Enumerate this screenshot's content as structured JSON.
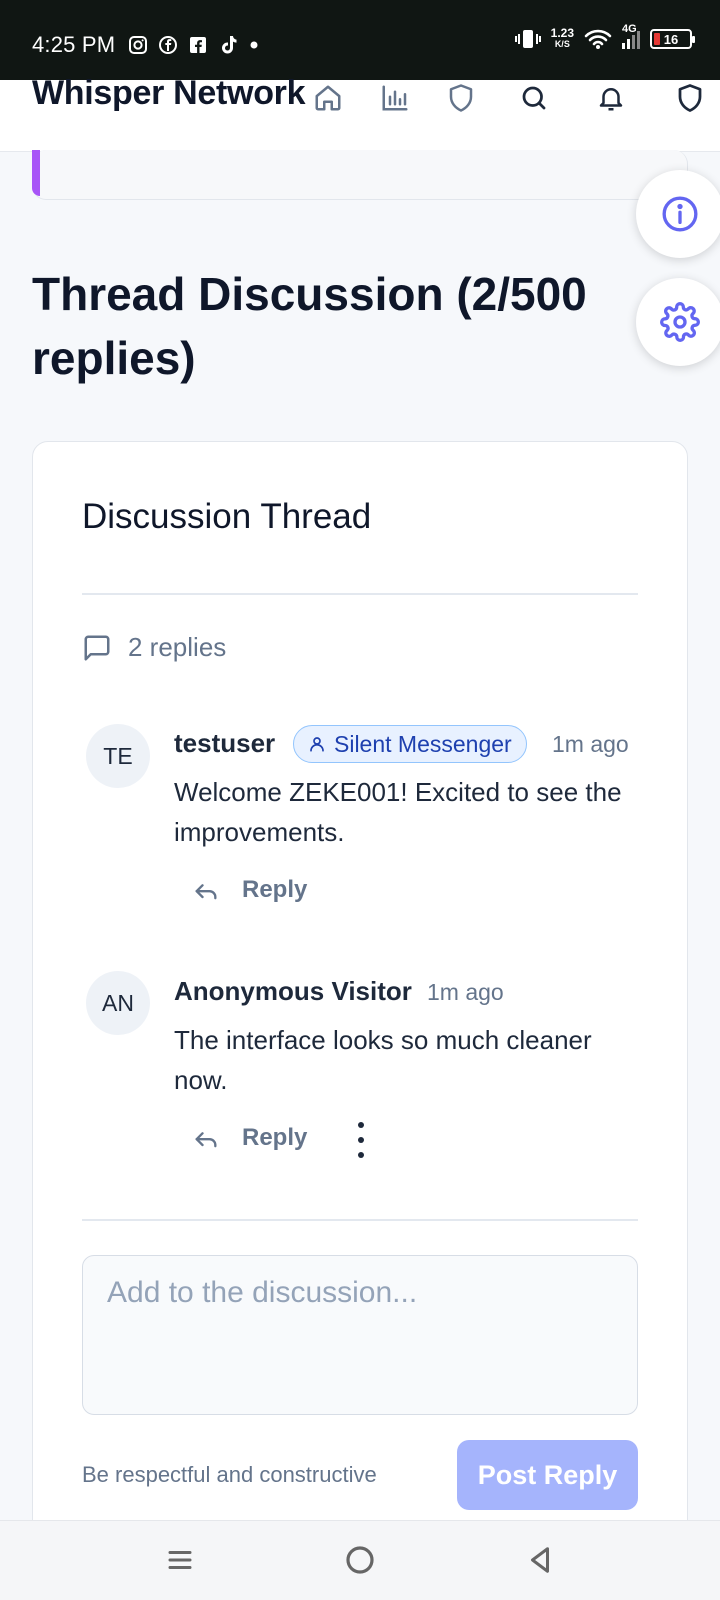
{
  "status_bar": {
    "time": "4:25 PM",
    "speed_value": "1.23",
    "speed_unit": "K/S",
    "network": "4G",
    "battery": "16"
  },
  "header": {
    "title": "Whisper Network",
    "icons": [
      "home-icon",
      "chart-icon",
      "shield-icon",
      "search-icon",
      "bell-icon",
      "shield-icon"
    ]
  },
  "section": {
    "title": "Thread Discussion (2/500 replies)"
  },
  "thread": {
    "title": "Discussion Thread",
    "reply_count_label": "2 replies",
    "replies": [
      {
        "initials": "TE",
        "author": "testuser",
        "badge": "Silent Messenger",
        "time": "1m ago",
        "text": "Welcome ZEKE001! Excited to see the improvements.",
        "reply_label": "Reply"
      },
      {
        "initials": "AN",
        "author": "Anonymous Visitor",
        "time": "1m ago",
        "text": "The interface looks so much cleaner now.",
        "reply_label": "Reply"
      }
    ]
  },
  "composer": {
    "placeholder": "Add to the discussion...",
    "hint": "Be respectful and constructive",
    "submit_label": "Post Reply"
  },
  "colors": {
    "accent": "#6366f1",
    "accent_disabled": "#a5b4fc",
    "purple_bar": "#a855f7",
    "badge_bg": "#e8f1ff",
    "badge_text": "#1e40af"
  }
}
